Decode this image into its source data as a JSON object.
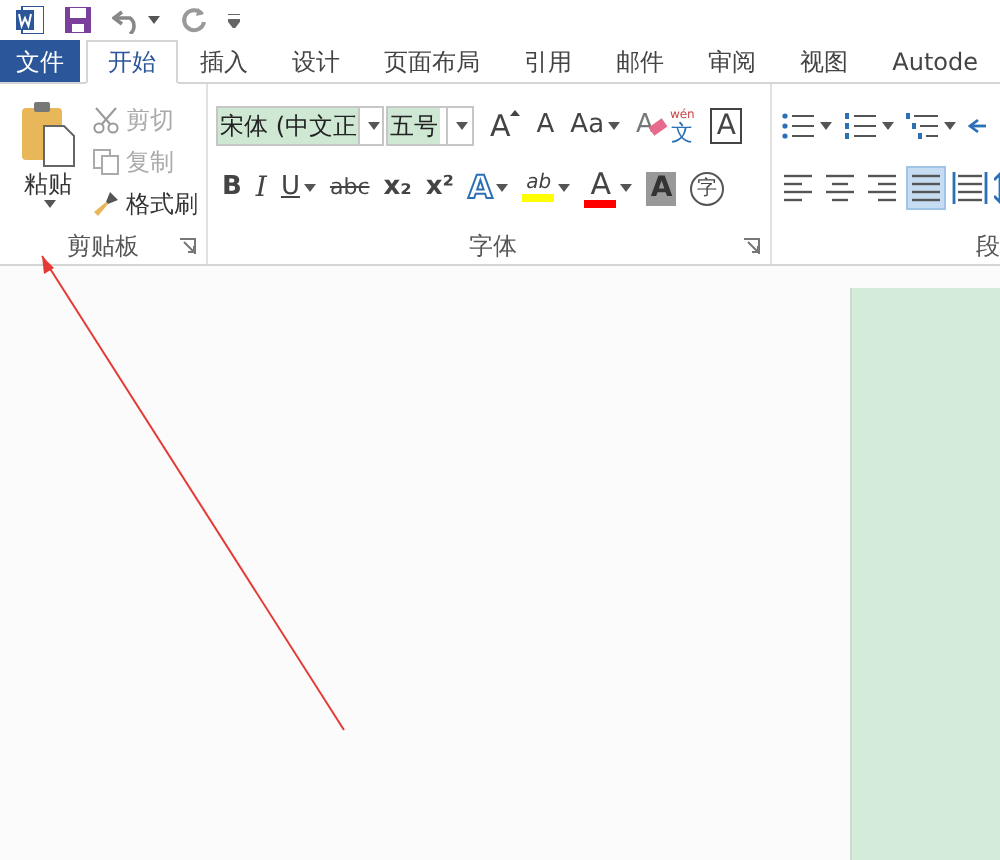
{
  "tabs": [
    {
      "label": "文件",
      "kind": "file",
      "selected": false
    },
    {
      "label": "开始",
      "kind": "tab",
      "selected": true
    },
    {
      "label": "插入",
      "kind": "tab",
      "selected": false
    },
    {
      "label": "设计",
      "kind": "tab",
      "selected": false
    },
    {
      "label": "页面布局",
      "kind": "tab",
      "selected": false
    },
    {
      "label": "引用",
      "kind": "tab",
      "selected": false
    },
    {
      "label": "邮件",
      "kind": "tab",
      "selected": false
    },
    {
      "label": "审阅",
      "kind": "tab",
      "selected": false
    },
    {
      "label": "视图",
      "kind": "tab",
      "selected": false
    },
    {
      "label": "Autode",
      "kind": "tab",
      "selected": false
    }
  ],
  "clipboard": {
    "paste": "粘贴",
    "label": "剪贴板",
    "items": [
      {
        "label": "剪切",
        "kind": "cut",
        "disabled": true
      },
      {
        "label": "复制",
        "kind": "copy",
        "disabled": true
      },
      {
        "label": "格式刷",
        "kind": "painter",
        "disabled": false
      }
    ]
  },
  "font": {
    "label": "字体",
    "font_name": "宋体 (中文正",
    "font_size": "五号",
    "row1": [
      {
        "glyph": "A",
        "kind": "grow"
      },
      {
        "glyph": "A",
        "kind": "shrink"
      },
      {
        "glyph": "Aa",
        "kind": "case",
        "dropdown": true
      },
      {
        "glyph": "A",
        "kind": "clear"
      },
      {
        "glyph": "文",
        "kind": "pinyin",
        "ruby": "wén"
      },
      {
        "glyph": "A",
        "kind": "boxed"
      }
    ],
    "row2": [
      {
        "glyph": "B",
        "kind": "bold"
      },
      {
        "glyph": "I",
        "kind": "italic"
      },
      {
        "glyph": "U",
        "kind": "underline",
        "dropdown": true
      },
      {
        "glyph": "abc",
        "kind": "strike"
      },
      {
        "glyph": "x₂",
        "kind": "sub"
      },
      {
        "glyph": "x²",
        "kind": "super"
      },
      {
        "glyph": "A",
        "kind": "effect",
        "dropdown": true
      },
      {
        "glyph": "ab",
        "kind": "highlight",
        "color": "#ffff00",
        "dropdown": true
      },
      {
        "glyph": "A",
        "kind": "color",
        "color": "#ff0000",
        "dropdown": true
      },
      {
        "glyph": "A",
        "kind": "shade"
      },
      {
        "glyph": "字",
        "kind": "enclose"
      }
    ]
  },
  "paragraph": {
    "label": "段",
    "row1": [
      {
        "kind": "bullets"
      },
      {
        "kind": "numbering"
      },
      {
        "kind": "multilevel"
      },
      {
        "kind": "outdent"
      }
    ],
    "row2": [
      {
        "kind": "left",
        "selected": false
      },
      {
        "kind": "center",
        "selected": false
      },
      {
        "kind": "right",
        "selected": false
      },
      {
        "kind": "justify",
        "selected": true
      },
      {
        "kind": "distributed",
        "selected": false
      },
      {
        "kind": "spacing",
        "selected": false
      }
    ]
  }
}
